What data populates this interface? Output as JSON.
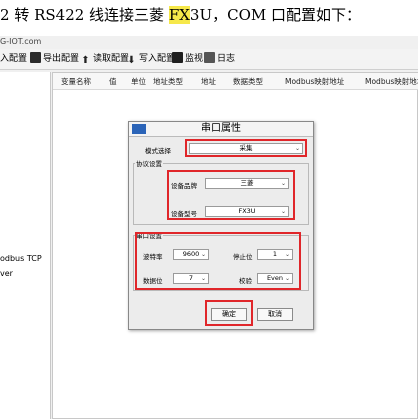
{
  "doc": {
    "text_before": "2 转 RS422 线连接三菱 ",
    "highlight": "FX",
    "text_after": "3U，COM 口配置如下："
  },
  "screenshot": {
    "url_fragment": "G-IOT.com",
    "toolbar": [
      {
        "label": "入配置",
        "icon": "import-icon"
      },
      {
        "label": "导出配置",
        "icon": "export-icon"
      },
      {
        "label": "读取配置",
        "icon": "read-config-icon"
      },
      {
        "label": "写入配置",
        "icon": "write-config-icon"
      },
      {
        "label": "监视",
        "icon": "monitor-icon"
      },
      {
        "label": "日志",
        "icon": "log-icon"
      }
    ],
    "left_panel": [
      "odbus TCP",
      "ver"
    ],
    "table_headers": [
      "变量名称",
      "值",
      "单位",
      "地址类型",
      "地址",
      "数据类型",
      "Modbus映射地址",
      "Modbus映射地址"
    ],
    "dialog": {
      "title": "串口属性",
      "mode_label": "模式选择",
      "mode_value": "采集",
      "protocol_group": "协议设置",
      "brand_label": "设备品牌",
      "brand_value": "三菱",
      "model_label": "设备型号",
      "model_value": "FX3U",
      "serial_group": "串口设置",
      "baud_label": "波特率",
      "baud_value": "9600",
      "stop_label": "停止位",
      "stop_value": "1",
      "data_label": "数据位",
      "data_value": "7",
      "parity_label": "校验",
      "parity_value": "Even",
      "ok_label": "确定",
      "cancel_label": "取消"
    },
    "colors": {
      "highlight_box": "#e0262a",
      "text_highlight": "#f6e84a"
    }
  }
}
